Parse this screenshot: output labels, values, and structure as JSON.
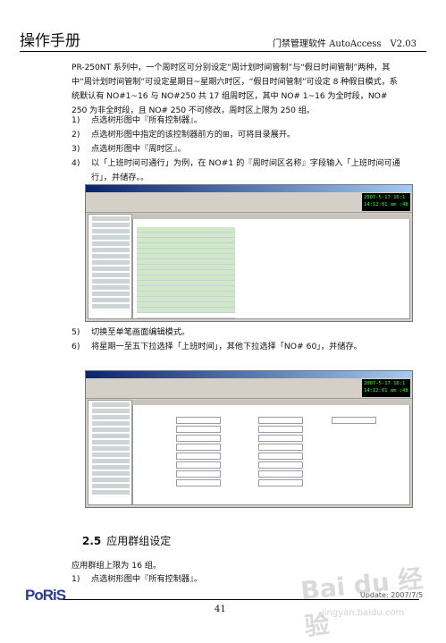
{
  "header": {
    "left_title": "操作手册",
    "right_title": "门禁管理软件 AutoAccess　V2.03"
  },
  "intro": {
    "text": "PR-250NT 系列中，一个周时区可分别设定“周计划时间管制”与“假日时间管制”两种，其中“周计划时间管制”可设定星期日~星期六时区，“假日时间管制”可设定 8 种假日模式，系统默认有 NO#1~16 与 NO#250 共 17 组周时区，其中 NO# 1~16 为全时段，NO# 250 为非全时段，且 NO# 250 不可修改，周时区上限为 250 组。"
  },
  "steps_a": [
    {
      "num": "1)",
      "text": "点选树形图中『所有控制器』。"
    },
    {
      "num": "2)",
      "text": "点选树形图中指定的该控制器前方的⊞，可将目录展开。"
    },
    {
      "num": "3)",
      "text": "点选树形图中『周时区』。"
    },
    {
      "num": "4)",
      "text": "以「上班时间可通行」为例，在 NO#1 的『周时间区名称』字段输入「上班时间可通行」，并储存。。"
    }
  ],
  "steps_b": [
    {
      "num": "5)",
      "text": "切换至单笔画面编辑模式。"
    },
    {
      "num": "6)",
      "text": "将星期一至五下拉选择「上班时间」，其他下拉选择「NO# 60」，并储存。"
    }
  ],
  "screenshot1": {
    "clock_lines": [
      "2007-5-17  16:1",
      "14:12:01 am  :48"
    ]
  },
  "screenshot2": {
    "clock_lines": [
      "2007-5-17  16:1",
      "14:12:01 am  :48"
    ]
  },
  "section": {
    "number": "2.5",
    "title": "应用群组设定"
  },
  "section_body": {
    "text": "应用群组上限为 16 组。",
    "step": {
      "num": "1)",
      "text": "点选树形图中『所有控制器』。"
    }
  },
  "footer": {
    "logo": "PoRiS",
    "page": "41",
    "update": "Update: 2007/7/5",
    "watermark": "Bai du 经验",
    "watermark_url": "jingyan.baidu.com"
  }
}
